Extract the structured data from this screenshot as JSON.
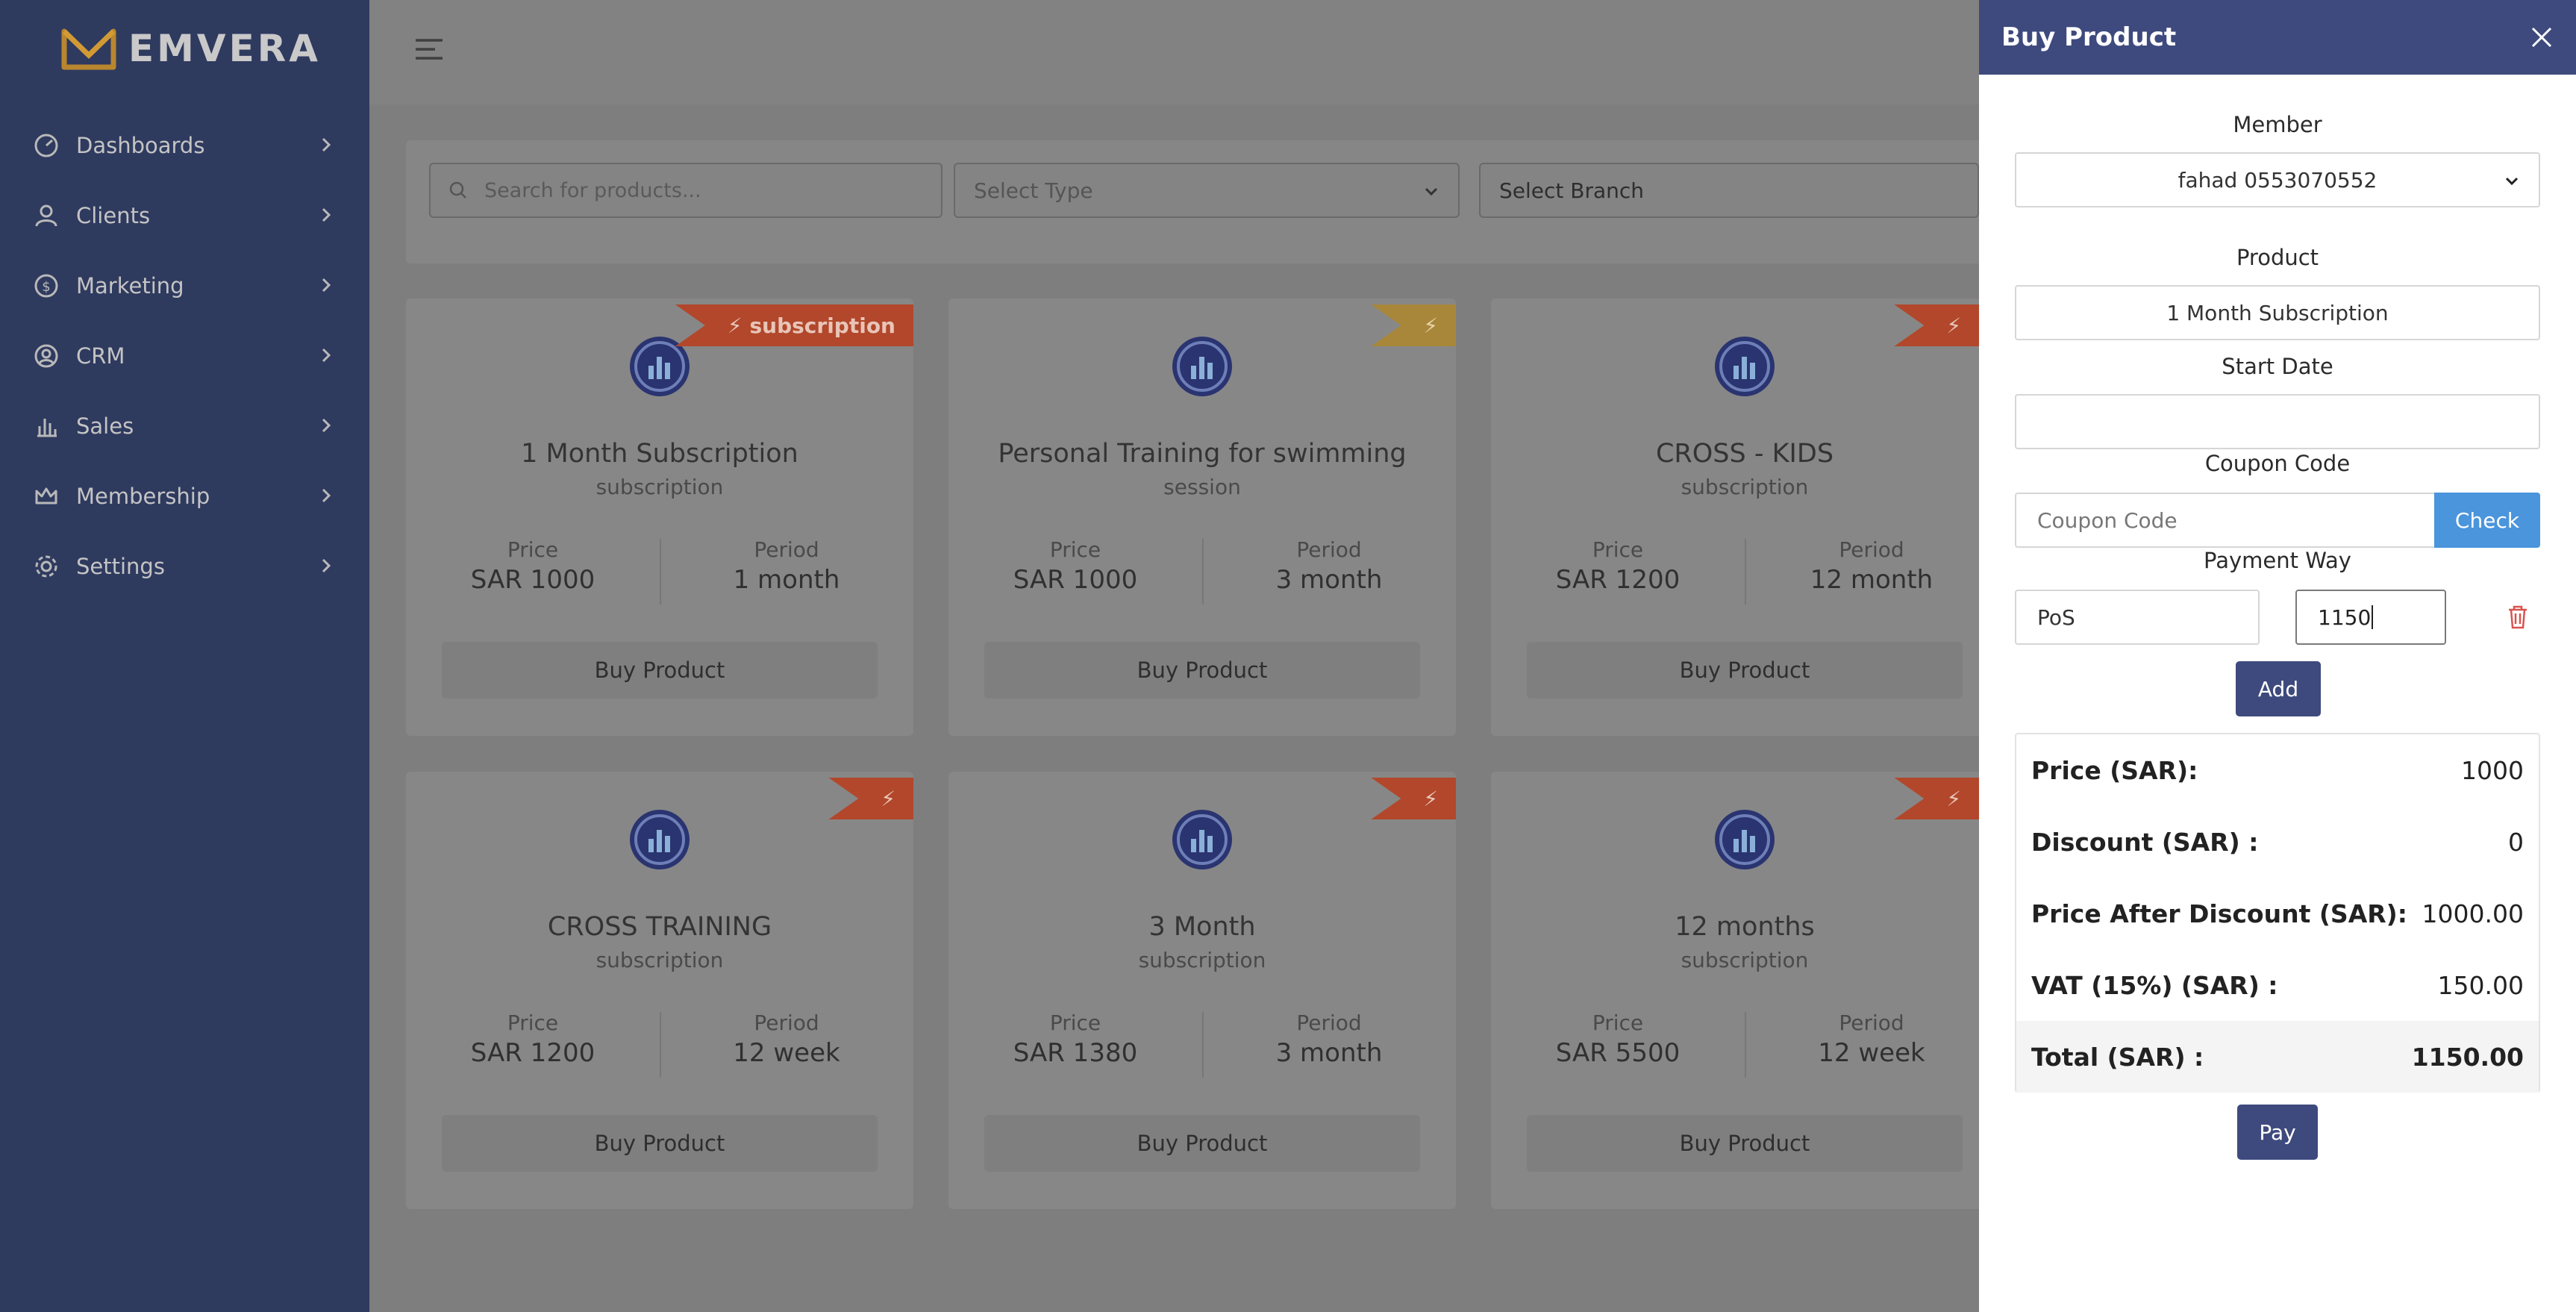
{
  "brand": {
    "name": "EMVERA"
  },
  "sidebar": {
    "items": [
      {
        "label": "Dashboards",
        "icon": "dashboard-icon"
      },
      {
        "label": "Clients",
        "icon": "user-icon"
      },
      {
        "label": "Marketing",
        "icon": "dollar-icon"
      },
      {
        "label": "CRM",
        "icon": "user-circle-icon"
      },
      {
        "label": "Sales",
        "icon": "bar-chart-icon"
      },
      {
        "label": "Membership",
        "icon": "crown-icon"
      },
      {
        "label": "Settings",
        "icon": "gear-icon"
      }
    ]
  },
  "filters": {
    "search_placeholder": "Search for products...",
    "type_select": "Select Type",
    "branch_select": "Select Branch"
  },
  "cards": [
    {
      "title": "1 Month Subscription",
      "subtitle": "subscription",
      "ribbon": "subscription",
      "price_label": "Price",
      "price": "SAR 1000",
      "period_label": "Period",
      "period": "1 month",
      "button": "Buy Product"
    },
    {
      "title": "Personal Training for swimming",
      "subtitle": "session",
      "ribbon": "",
      "price_label": "Price",
      "price": "SAR 1000",
      "period_label": "Period",
      "period": "3 month",
      "button": "Buy Product"
    },
    {
      "title": "CROSS - KIDS",
      "subtitle": "subscription",
      "ribbon": "",
      "price_label": "Price",
      "price": "SAR 1200",
      "period_label": "Period",
      "period": "12 month",
      "button": "Buy Product"
    },
    {
      "title": "CROSS TRAINING",
      "subtitle": "subscription",
      "ribbon": "",
      "price_label": "Price",
      "price": "SAR 1200",
      "period_label": "Period",
      "period": "12 week",
      "button": "Buy Product"
    },
    {
      "title": "3 Month",
      "subtitle": "subscription",
      "ribbon": "",
      "price_label": "Price",
      "price": "SAR 1380",
      "period_label": "Period",
      "period": "3 month",
      "button": "Buy Product"
    },
    {
      "title": "12 months",
      "subtitle": "subscription",
      "ribbon": "",
      "price_label": "Price",
      "price": "SAR 5500",
      "period_label": "Period",
      "period": "12 week",
      "button": "Buy Product"
    }
  ],
  "panel": {
    "title": "Buy Product",
    "member_label": "Member",
    "member_value": "fahad 0553070552",
    "product_label": "Product",
    "product_value": "1 Month Subscription",
    "start_date_label": "Start Date",
    "start_date_value": "",
    "coupon_label": "Coupon Code",
    "coupon_placeholder": "Coupon Code",
    "check_button": "Check",
    "payment_label": "Payment Way",
    "payment_method": "PoS",
    "payment_amount": "1150",
    "add_button": "Add",
    "summary": [
      {
        "label": "Price (SAR):",
        "value": "1000"
      },
      {
        "label": "Discount (SAR) :",
        "value": "0"
      },
      {
        "label": "Price After Discount (SAR):",
        "value": "1000.00"
      },
      {
        "label": "VAT (15%) (SAR) :",
        "value": "150.00"
      },
      {
        "label": "Total (SAR) :",
        "value": "1150.00"
      }
    ],
    "pay_button": "Pay"
  },
  "colors": {
    "sidebar_bg": "#2f3a5f",
    "panel_header": "#3e4a7d",
    "check_button": "#4a95dc",
    "ribbon_red": "#b2472b",
    "ribbon_gold": "#a8873a",
    "trash": "#d9534f"
  }
}
